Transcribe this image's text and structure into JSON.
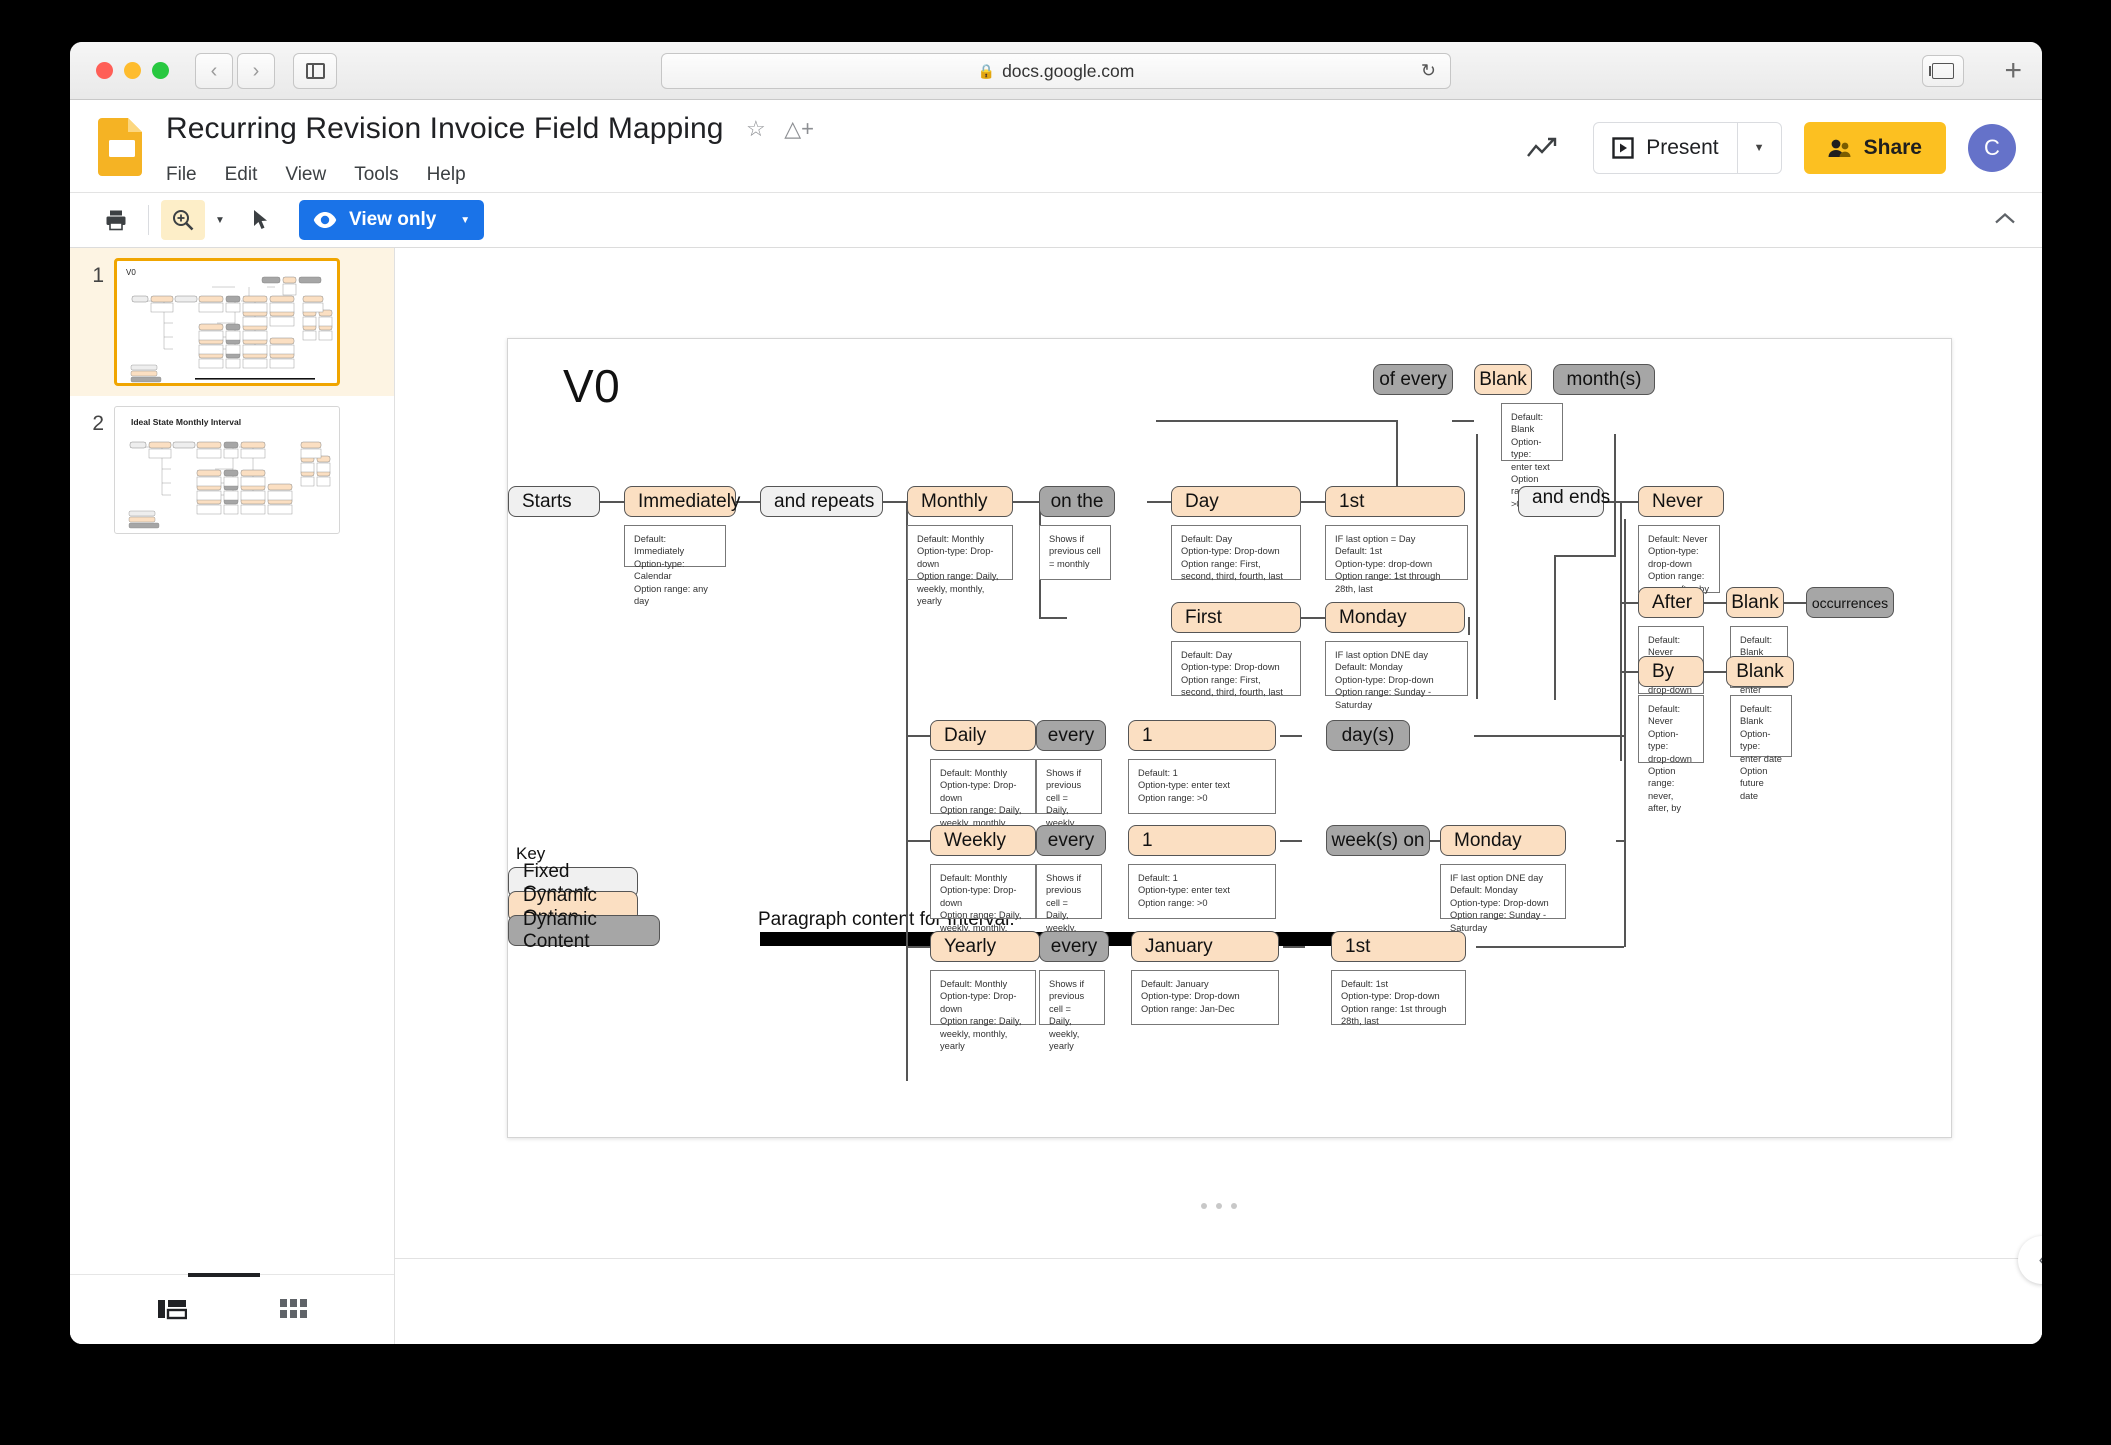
{
  "browser": {
    "url": "docs.google.com",
    "lock_icon": "lock-icon",
    "back_icon": "‹",
    "forward_icon": "›",
    "reload_icon": "↻",
    "new_tab_icon": "+"
  },
  "header": {
    "doc_title": "Recurring Revision Invoice Field Mapping",
    "star_icon": "☆",
    "drive_icon": "drive-icon",
    "menus": [
      "File",
      "Edit",
      "View",
      "Tools",
      "Help"
    ],
    "trend_icon": "activity-icon",
    "present_label": "Present",
    "present_caret": "▼",
    "share_label": "Share",
    "avatar_initial": "C"
  },
  "toolbar": {
    "print_icon": "print-icon",
    "zoom_icon": "zoom-in-icon",
    "zoom_caret": "▼",
    "select_icon": "cursor-icon",
    "view_only_label": "View only",
    "view_only_caret": "▼",
    "collapse_icon": "⌃"
  },
  "filmstrip": {
    "slides": [
      {
        "number": "1",
        "title": "V0",
        "active": true
      },
      {
        "number": "2",
        "title": "Ideal State Monthly Interval",
        "active": false
      }
    ],
    "footer": {
      "filmstrip_view_icon": "filmstrip-view-icon",
      "grid_view_icon": "grid-view-icon"
    }
  },
  "canvas": {
    "collapse_right_icon": "‹"
  },
  "slide": {
    "title": "V0",
    "key": {
      "label": "Key",
      "items": [
        {
          "label": "Fixed Content",
          "color": "#f0f0f0"
        },
        {
          "label": "Dynamic Option",
          "color": "#fbdfc2"
        },
        {
          "label": "Dynamic Content",
          "color": "#a6a6a6"
        }
      ]
    },
    "paragraph_label": "Paragraph content for Interval:",
    "paragraph_redacted": true,
    "nodes": {
      "starts": {
        "label": "Starts",
        "type": "fixed"
      },
      "immediately": {
        "label": "Immediately",
        "type": "option"
      },
      "and_repeats": {
        "label": "and repeats",
        "type": "fixed"
      },
      "monthly": {
        "label": "Monthly",
        "type": "option"
      },
      "on_the": {
        "label": "on the",
        "type": "content"
      },
      "day": {
        "label": "Day",
        "type": "option"
      },
      "first_num": {
        "label": "1st",
        "type": "option"
      },
      "first": {
        "label": "First",
        "type": "option"
      },
      "monday_top": {
        "label": "Monday",
        "type": "option"
      },
      "of_every": {
        "label": "of every",
        "type": "content"
      },
      "blank_month": {
        "label": "Blank",
        "type": "option"
      },
      "months": {
        "label": "month(s)",
        "type": "content"
      },
      "and_ends": {
        "label": "and ends",
        "type": "fixed"
      },
      "never": {
        "label": "Never",
        "type": "option"
      },
      "after": {
        "label": "After",
        "type": "option"
      },
      "blank_after": {
        "label": "Blank",
        "type": "option"
      },
      "occurrences": {
        "label": "occurrences",
        "type": "content"
      },
      "by": {
        "label": "By",
        "type": "option"
      },
      "blank_by": {
        "label": "Blank",
        "type": "option"
      },
      "daily": {
        "label": "Daily",
        "type": "option"
      },
      "every_daily": {
        "label": "every",
        "type": "content"
      },
      "one_daily": {
        "label": "1",
        "type": "option"
      },
      "days": {
        "label": "day(s)",
        "type": "content"
      },
      "weekly": {
        "label": "Weekly",
        "type": "option"
      },
      "every_weekly": {
        "label": "every",
        "type": "content"
      },
      "one_weekly": {
        "label": "1",
        "type": "option"
      },
      "weeks_on": {
        "label": "week(s) on",
        "type": "content"
      },
      "monday_weekly": {
        "label": "Monday",
        "type": "option"
      },
      "yearly": {
        "label": "Yearly",
        "type": "option"
      },
      "every_yearly": {
        "label": "every",
        "type": "content"
      },
      "january": {
        "label": "January",
        "type": "option"
      },
      "first_yearly": {
        "label": "1st",
        "type": "option"
      }
    },
    "notes": {
      "immediately": "Default: Immediately\nOption-type: Calendar\nOption range: any day",
      "monthly": "Default: Monthly\nOption-type: Drop-down\nOption range: Daily, weekly, monthly, yearly",
      "on_the": "Shows if previous cell = monthly",
      "day": "Default: Day\nOption-type: Drop-down\nOption range: First, second, third, fourth, last",
      "first_num": "IF last option = Day\nDefault: 1st\nOption-type: drop-down\nOption range: 1st through 28th, last",
      "first": "Default: Day\nOption-type: Drop-down\nOption range: First, second, third, fourth, last",
      "monday_top": "IF last option DNE day\nDefault: Monday\nOption-type: Drop-down\nOption range: Sunday - Saturday",
      "blank_month": "Default:\nBlank\nOption-type:\nenter text\nOption range:\n>0",
      "never": "Default: Never\nOption-type:\ndrop-down\nOption range:\nnever, after, by",
      "after": "Default: Never\nOption-type:\ndrop-down\nOption range:\nnever, after, by",
      "blank_after": "Default:\nBlank\nOption-type:\nenter text\nOption range:\n>0",
      "by": "Default: Never\nOption-type:\ndrop-down\nOption range:\nnever, after, by",
      "blank_by": "Default:\nBlank\nOption-type:\nenter date\nOption future\ndate",
      "daily": "Default: Monthly\nOption-type: Drop-down\nOption range: Daily, weekly, monthly, yearly",
      "every_daily": "Shows if previous cell = Daily, weekly, yearly",
      "one_daily": "Default: 1\nOption-type: enter text\nOption range: >0",
      "weekly": "Default: Monthly\nOption-type: Drop-down\nOption range: Daily, weekly, monthly, yearly",
      "every_weekly": "Shows if previous cell = Daily, weekly, yearly",
      "one_weekly": "Default: 1\nOption-type: enter text\nOption range: >0",
      "monday_weekly": "IF last option DNE day\nDefault: Monday\nOption-type: Drop-down\nOption range: Sunday - Saturday",
      "yearly": "Default: Monthly\nOption-type: Drop-down\nOption range: Daily, weekly, monthly, yearly",
      "every_yearly": "Shows if previous cell = Daily, weekly, yearly",
      "january": "Default: January\nOption-type: Drop-down\nOption range: Jan-Dec",
      "first_yearly": "Default: 1st\nOption-type: Drop-down\nOption range: 1st through 28th, last"
    }
  }
}
